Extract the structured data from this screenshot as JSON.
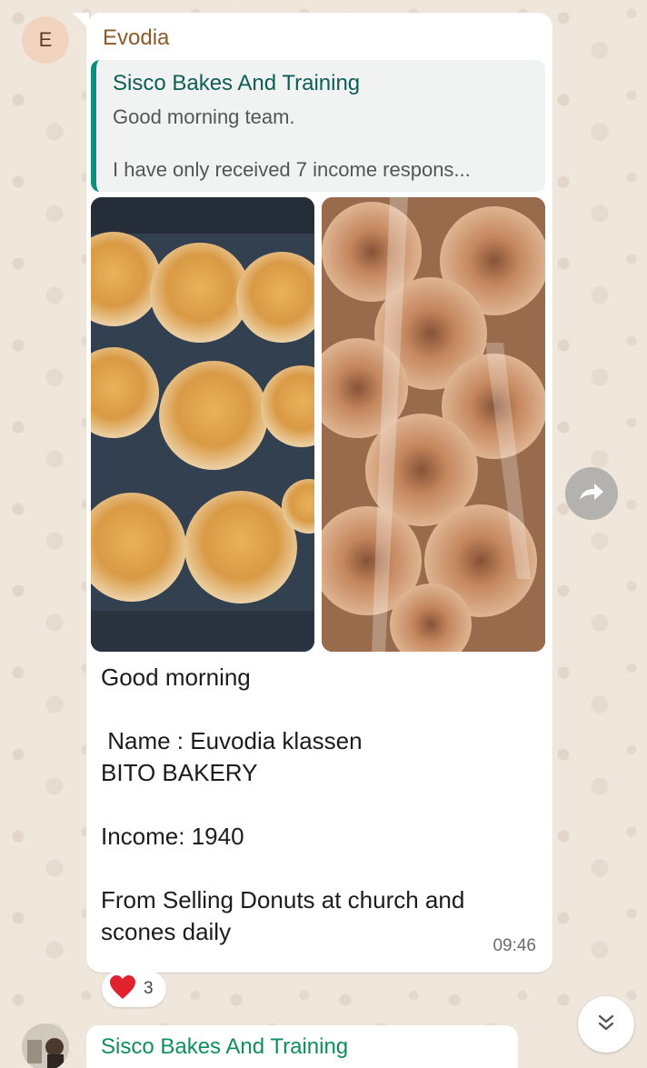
{
  "message": {
    "avatar_letter": "E",
    "sender": "Evodia",
    "quoted": {
      "author": "Sisco Bakes And Training",
      "line1": "Good morning team.",
      "line2": "I have only received 7 income respons..."
    },
    "images": [
      {
        "icon": "scones-photo"
      },
      {
        "icon": "donuts-photo"
      }
    ],
    "text_lines": [
      "Good morning",
      "",
      " Name : Euvodia klassen",
      "BITO BAKERY",
      "",
      "Income: 1940",
      "",
      "From Selling Donuts at church and",
      "scones daily"
    ],
    "time": "09:46",
    "reaction": {
      "emoji": "heart",
      "count": "3"
    }
  },
  "next_message": {
    "sender": "Sisco Bakes And Training"
  },
  "colors": {
    "sender_name": "#8a5a2b",
    "quote_bar": "#0e8f7e",
    "chat_bg": "#efe7dc"
  }
}
